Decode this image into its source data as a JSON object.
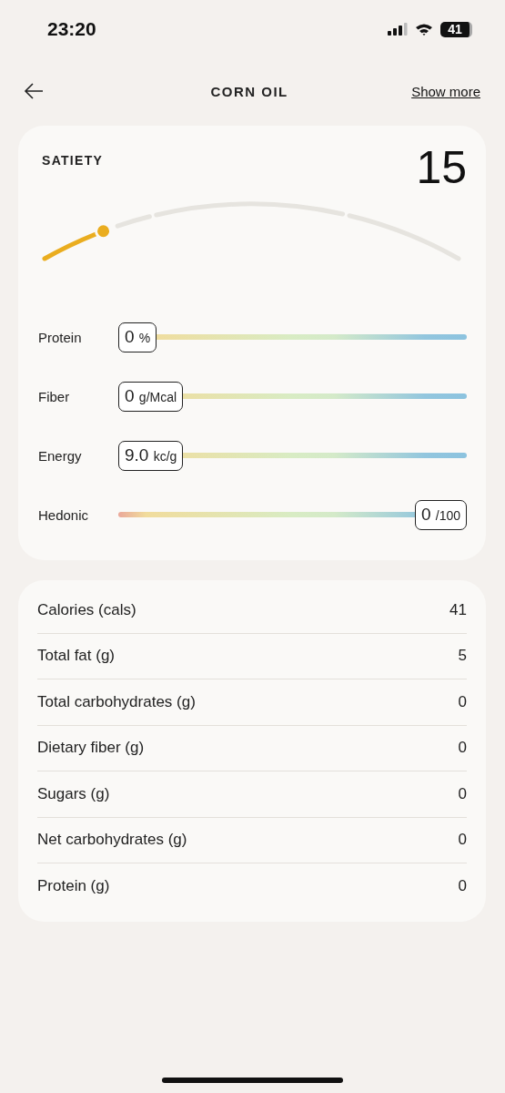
{
  "status_bar": {
    "time": "23:20",
    "battery": "41"
  },
  "header": {
    "title": "CORN OIL",
    "action": "Show more"
  },
  "satiety": {
    "title": "SATIETY",
    "score": "15"
  },
  "meters": [
    {
      "label": "Protein",
      "value": "0",
      "unit": "%",
      "at_end": false
    },
    {
      "label": "Fiber",
      "value": "0",
      "unit": "g/Mcal",
      "at_end": false
    },
    {
      "label": "Energy",
      "value": "9.0",
      "unit": "kc/g",
      "at_end": false
    },
    {
      "label": "Hedonic",
      "value": "0",
      "unit": "/100",
      "at_end": true
    }
  ],
  "nutrients": [
    {
      "label": "Calories (cals)",
      "value": "41"
    },
    {
      "label": "Total fat (g)",
      "value": "5"
    },
    {
      "label": "Total carbohydrates (g)",
      "value": "0"
    },
    {
      "label": "Dietary fiber (g)",
      "value": "0"
    },
    {
      "label": "Sugars (g)",
      "value": "0"
    },
    {
      "label": "Net carbohydrates (g)",
      "value": "0"
    },
    {
      "label": "Protein (g)",
      "value": "0"
    }
  ]
}
